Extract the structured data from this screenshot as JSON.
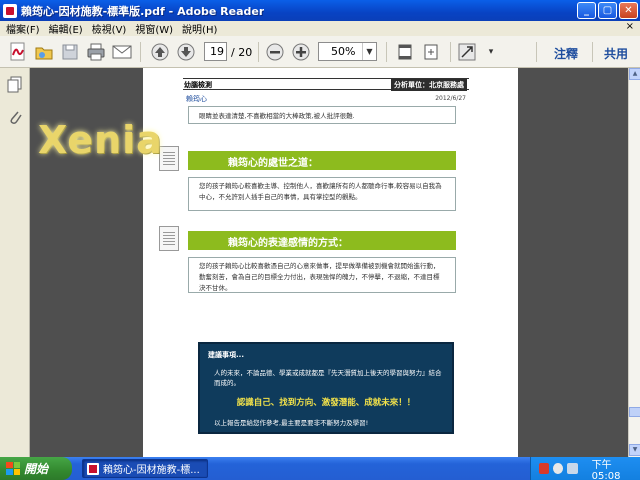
{
  "window": {
    "title": "賴筠心-因材施教-標準版.pdf - Adobe Reader",
    "buttons": [
      "_",
      "▢",
      "✕"
    ]
  },
  "menu": {
    "items": [
      "檔案(F)",
      "編輯(E)",
      "檢視(V)",
      "視窗(W)",
      "說明(H)"
    ],
    "close": "×"
  },
  "toolbar": {
    "page_current": "19",
    "page_total": "/ 20",
    "zoom": "50%",
    "comment_label": "注釋",
    "share_label": "共用"
  },
  "document": {
    "watermark": "Xenia",
    "header": {
      "left": "幼腦檢測",
      "right": "分析單位：北京服務處",
      "name": "賴筠心",
      "date": "2012/6/27"
    },
    "top_fragment": "眼睛並表達清楚,不喜歡相當的大棒政策,被人批評很難.",
    "section1": {
      "title": "賴筠心的處世之道：",
      "text": "您的孩子賴筠心較喜歡主導、控制他人，喜歡讓所有的人都聽命行事,較容易以自我為中心，不允許別人插手自己的事情，具有掌控型的觀點。"
    },
    "section2": {
      "title": "賴筠心的表達感情的方式：",
      "text": "您的孩子賴筠心比較喜歡憑自己的心意來做事，提早做準備被到機會就開始進行動，勤奮刻苦，會為自己的目標全力付出，表現強悍的魄力，不停擊，不退縮，不達目標決不甘休。"
    },
    "advice": {
      "title": "建議事項...",
      "body": "人的未來，不論品德、學業或成就都是『先天潛質加上後天的學習與努力』結合而成的。",
      "highlight": "認識自己、找到方向、激發潛能、成就未來！！",
      "footer": "以上報告是給您作參考,最主要是要非不斷努力及學習!"
    }
  },
  "taskbar": {
    "start_label": "開始",
    "task_label": "賴筠心-因材施教-標...",
    "clock": "下午 05:08"
  },
  "colors": {
    "section_bar": "#8dbb1e",
    "advice_bg": "#0f3b5c",
    "highlight": "#f3e24a",
    "link": "#1f4e9e"
  }
}
